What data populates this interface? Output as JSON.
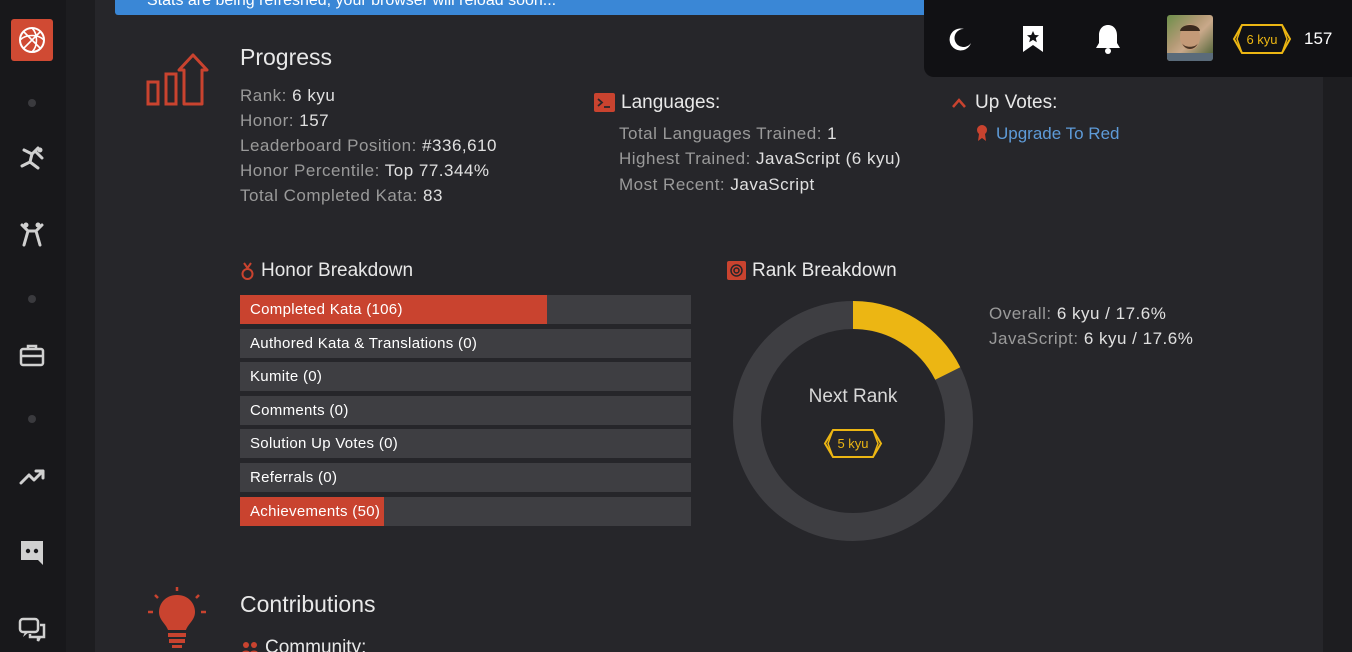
{
  "banner": {
    "text": "Stats are being refreshed, your browser will reload soon..."
  },
  "topbar": {
    "rank_badge": "6 kyu",
    "honor": "157"
  },
  "progress": {
    "title": "Progress",
    "stats": [
      {
        "label": "Rank:",
        "value": "6 kyu"
      },
      {
        "label": "Honor:",
        "value": "157"
      },
      {
        "label": "Leaderboard Position:",
        "value": "#336,610"
      },
      {
        "label": "Honor Percentile:",
        "value": "Top 77.344%"
      },
      {
        "label": "Total Completed Kata:",
        "value": "83"
      }
    ]
  },
  "languages": {
    "title": "Languages:",
    "stats": [
      {
        "label": "Total Languages Trained:",
        "value": "1"
      },
      {
        "label": "Highest Trained:",
        "value": "JavaScript (6 kyu)"
      },
      {
        "label": "Most Recent:",
        "value": "JavaScript"
      }
    ]
  },
  "upvotes": {
    "title": "Up Votes:",
    "link": "Upgrade To Red"
  },
  "honor_breakdown": {
    "title": "Honor Breakdown",
    "bars": [
      {
        "label": "Completed Kata (106)",
        "fill_fraction": 0.68
      },
      {
        "label": "Authored Kata & Translations (0)",
        "fill_fraction": 0
      },
      {
        "label": "Kumite (0)",
        "fill_fraction": 0
      },
      {
        "label": "Comments (0)",
        "fill_fraction": 0
      },
      {
        "label": "Solution Up Votes (0)",
        "fill_fraction": 0
      },
      {
        "label": "Referrals (0)",
        "fill_fraction": 0
      },
      {
        "label": "Achievements (50)",
        "fill_fraction": 0.32
      }
    ]
  },
  "rank_breakdown": {
    "title": "Rank Breakdown",
    "next_rank_label": "Next Rank",
    "next_rank_badge": "5 kyu",
    "progress_fraction": 0.176,
    "stats": [
      {
        "label": "Overall:",
        "value": "6 kyu / 17.6%"
      },
      {
        "label": "JavaScript:",
        "value": "6 kyu / 17.6%"
      }
    ]
  },
  "contributions": {
    "title": "Contributions",
    "community_label": "Community:"
  },
  "colors": {
    "accent": "#c9432f",
    "rank_yellow": "#ecb613",
    "link": "#5e9bd8",
    "banner": "#3a87d6"
  }
}
